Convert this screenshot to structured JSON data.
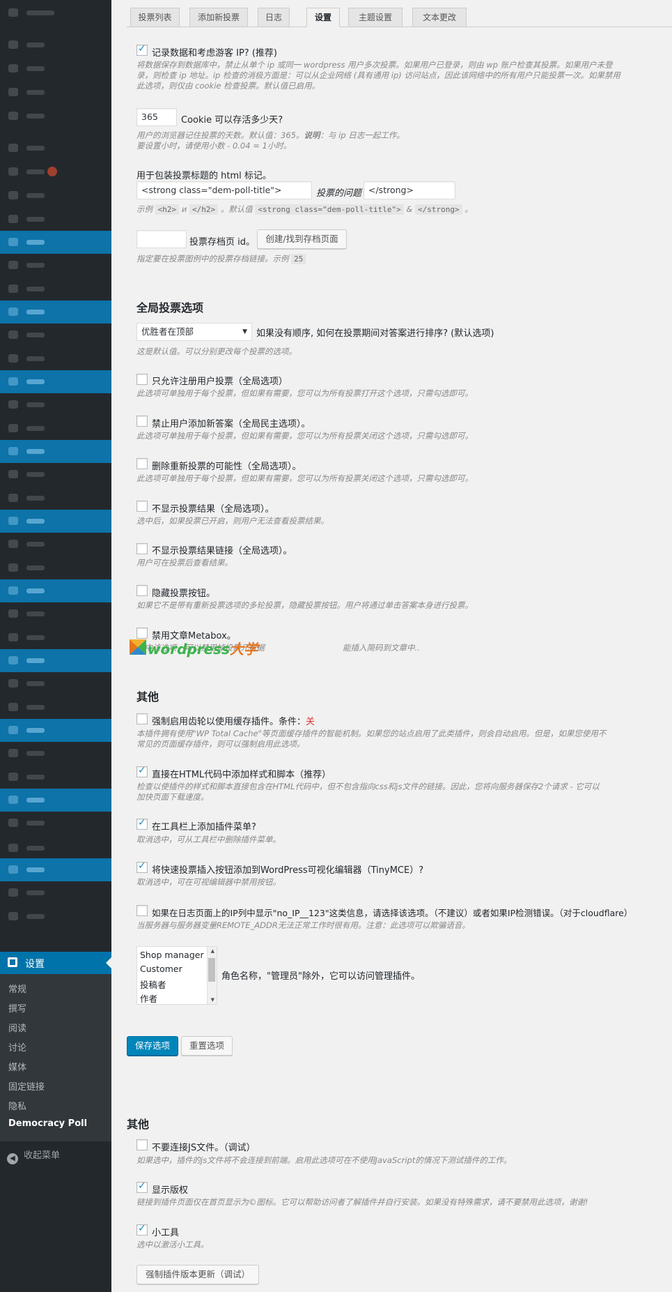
{
  "sidebar": {
    "settings_label": "设置",
    "submenu": [
      "常规",
      "撰写",
      "阅读",
      "讨论",
      "媒体",
      "固定链接",
      "隐私",
      "Democracy Poll"
    ],
    "collapse_label": "收起菜单",
    "accent_color": "#0073aa"
  },
  "tabs": [
    "投票列表",
    "添加新投票",
    "日志",
    "设置",
    "主题设置",
    "文本更改"
  ],
  "active_tab": "设置",
  "general": {
    "log_ip": {
      "checked": true,
      "label": "记录数据和考虑游客 IP? (推荐)",
      "desc1": "将数据保存到数据库中，禁止从单个 ip 或同一 wordpress 用户多次投票。如果用户已登录，则由 wp 账户检查其投票。如果用户未登",
      "desc2": "录，则检查 ip 地址。ip 检查的消极方面是：可以从企业网络 (具有通用 ip) 访问站点，因此该网络中的所有用户只能投票一次。如果禁用",
      "desc3": "此选项，则仅由 cookie 检查投票。默认值已启用。"
    },
    "cookie_days": {
      "value": "365",
      "label": "Cookie 可以存活多少天?",
      "desc1": "用户的浏览器记住投票的天数。默认值：365。",
      "desc1_strong": "说明",
      "desc1_end": "：与 ip 日志一起工作。",
      "desc2": "要设置小时，请使用小数 - 0.04 = 1小时。"
    },
    "html_title": {
      "label": "用于包装投票标题的 html 标记。",
      "open_value": "<strong class=\"dem-poll-title\">",
      "middle": "投票的问题",
      "close_value": "</strong>",
      "desc_prefix": "示例",
      "ex1": "<h2>",
      "ex_u": "и",
      "ex2": "</h2>",
      "desc_default": "。默认值",
      "ex3": "<strong class=\"dem-poll-title\">",
      "ex_amp": "&",
      "ex4": "</strong>",
      "desc_end": "。"
    },
    "archive": {
      "value": "",
      "label": "投票存档页 id。",
      "button": "创建/找到存档页面",
      "desc": "指定要在投票图例中的投票存档链接。示例",
      "example": "25"
    }
  },
  "global_section": {
    "heading": "全局投票选项",
    "order_select": {
      "value": "优胜者在顶部",
      "label": "如果没有顺序, 如何在投票期间对答案进行排序? (默认选项)",
      "desc": "这是默认值。可以分别更改每个投票的选项。"
    },
    "options": [
      {
        "checked": false,
        "label": "只允许注册用户投票（全局选项）",
        "desc": "此选项可单独用于每个投票，但如果有需要，您可以为所有投票打开这个选项，只需勾选即可。"
      },
      {
        "checked": false,
        "label": "禁止用户添加新答案（全局民主选项）。",
        "desc": "此选项可单独用于每个投票，但如果有需要，您可以为所有投票关闭这个选项，只需勾选即可。"
      },
      {
        "checked": false,
        "label": "删除重新投票的可能性（全局选项）。",
        "desc": "此选项可单独用于每个投票，但如果有需要，您可以为所有投票关闭这个选项，只需勾选即可。"
      },
      {
        "checked": false,
        "label": "不显示投票结果（全局选项）。",
        "desc": "选中后，如果投票已开启，则用户无法查看投票结果。"
      },
      {
        "checked": false,
        "label": "不显示投票结果链接（全局选项）。",
        "desc": "用户可在投票后查看结果。"
      },
      {
        "checked": false,
        "label": "隐藏投票按钮。",
        "desc": "如果它不是带有重新投票选项的多轮投票，隐藏投票按钮。用户将通过单击答案本身进行投票。"
      },
      {
        "checked": false,
        "label": "禁用文章Metabox。",
        "desc": "选中该选项，可以禁用掉投票元数据"
      }
    ]
  },
  "watermark": {
    "text_a": "wordpress",
    "text_b": "大学",
    "desc_tail": "能插入简码到文章中.."
  },
  "other_section": {
    "heading": "其他",
    "cache": {
      "checked": false,
      "label": "强制启用齿轮以使用缓存插件。条件：",
      "status": "关",
      "desc1": "本插件拥有使用\"WP Total Cache\"等页面缓存插件的智能机制。如果您的站点启用了此类插件，则会自动启用。但是，如果您使用不",
      "desc2": "常见的页面缓存插件，则可以强制启用此选项。"
    },
    "inline": {
      "checked": true,
      "label": "直接在HTML代码中添加样式和脚本（推荐）",
      "desc1": "检查以使插件的样式和脚本直接包含在HTML代码中，但不包含指向css和js文件的链接。因此，您将向服务器保存2个请求 - 它可以",
      "desc2": "加快页面下载速度。"
    },
    "toolbar": {
      "checked": true,
      "label": "在工具栏上添加插件菜单?",
      "desc": "取消选中，可从工具栏中删除插件菜单。"
    },
    "tinymce": {
      "checked": true,
      "label": "将快速投票插入按钮添加到WordPress可视化编辑器（TinyMCE）?",
      "desc": "取消选中，可在可视编辑器中禁用按钮。"
    },
    "ip_log": {
      "checked": false,
      "label": "如果在日志页面上的IP列中显示\"no_IP__123\"这类信息，请选择该选项。（不建议）或者如果IP检测错误。（对于cloudflare）",
      "desc": "当服务器与服务器变量REMOTE_ADDR无法正常工作时很有用。注意：此选项可以欺骗语音。"
    },
    "roles": {
      "options": [
        "Shop manager",
        "Customer",
        "投稿者",
        "作者"
      ],
      "label": "角色名称，\"管理员\"除外，它可以访问管理插件。"
    }
  },
  "buttons": {
    "save": "保存选项",
    "reset": "重置选项"
  },
  "debug_section": {
    "heading": "其他",
    "no_js": {
      "checked": false,
      "label": "不要连接JS文件。（调试）",
      "desc": "如果选中，插件的js文件将不会连接到前端。启用此选项可在不使用JavaScript的情况下测试插件的工作。"
    },
    "copyright": {
      "checked": true,
      "label": "显示版权",
      "desc": "链接到插件页面仅在首页显示为©图标。它可以帮助访问者了解插件并自行安装。如果没有特殊需求，请不要禁用此选项，谢谢!"
    },
    "widget": {
      "checked": true,
      "label": "小工具",
      "desc": "选中以激活小工具。"
    },
    "force_update": "强制插件版本更新（调试）"
  }
}
